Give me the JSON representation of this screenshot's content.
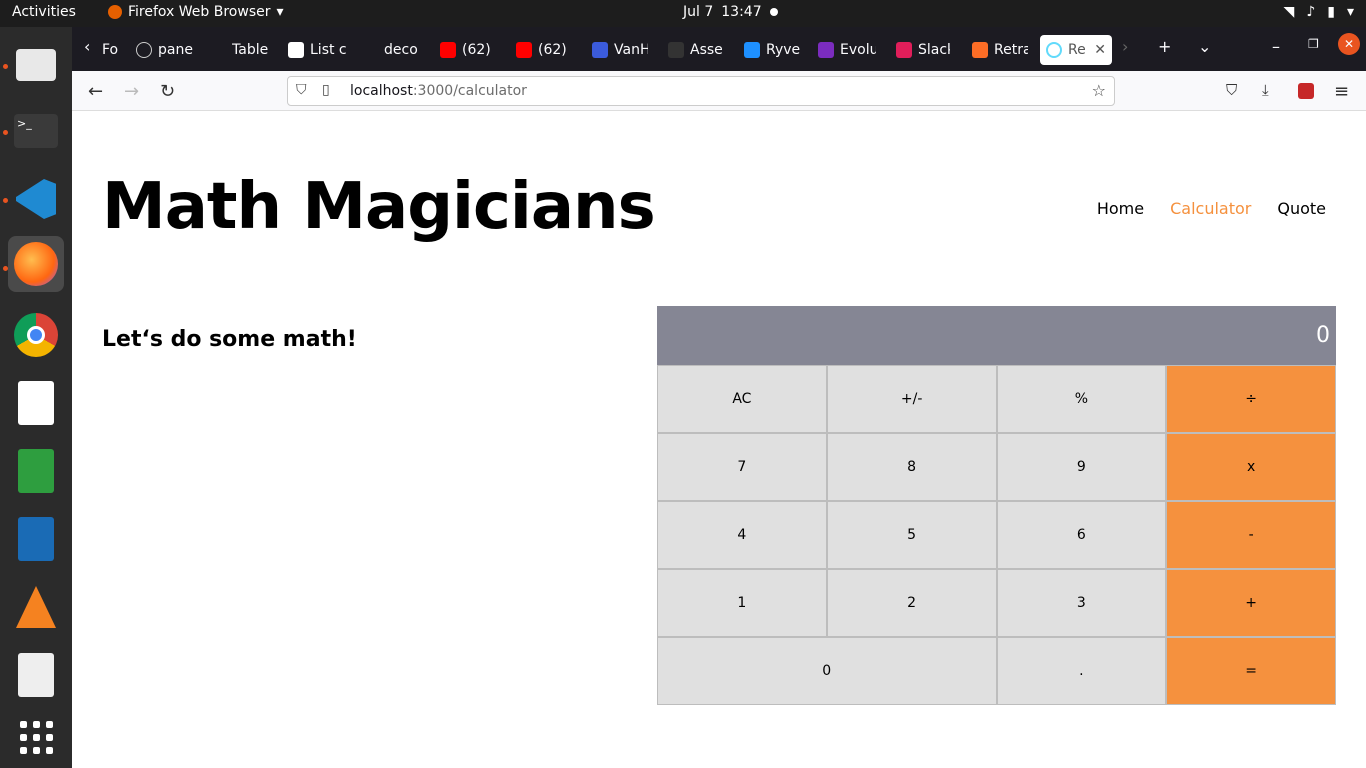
{
  "system": {
    "activities": "Activities",
    "app_name": "Firefox Web Browser",
    "date": "Jul 7",
    "time": "13:47"
  },
  "dock": [
    "files-icon",
    "terminal-icon",
    "vscode-icon",
    "firefox-icon",
    "chrome-icon",
    "text-editor-icon",
    "calc-icon",
    "writer-icon",
    "vlc-icon",
    "reader-icon",
    "apps-grid-icon"
  ],
  "tabs": [
    {
      "label": "Fo",
      "color": "#888"
    },
    {
      "label": "pane",
      "color": "#ccc"
    },
    {
      "label": "Table",
      "color": "#444"
    },
    {
      "label": "List c",
      "color": "#fff"
    },
    {
      "label": "deco",
      "color": "#444"
    },
    {
      "label": "(62)",
      "color": "#ff0000"
    },
    {
      "label": "(62)",
      "color": "#ff0000"
    },
    {
      "label": "VanH",
      "color": "#3b5bdb"
    },
    {
      "label": "Asse",
      "color": "#222"
    },
    {
      "label": "Ryve",
      "color": "#1e90ff"
    },
    {
      "label": "Evolu",
      "color": "#7b2cbf"
    },
    {
      "label": "Slack",
      "color": "#e01e5a"
    },
    {
      "label": "Retra",
      "color": "#fc6d26"
    },
    {
      "label": "Re",
      "color": "#61dafb"
    }
  ],
  "url": {
    "host": "localhost",
    "path": ":3000/calculator"
  },
  "page": {
    "logo": "Math Magicians",
    "nav": [
      "Home",
      "Calculator",
      "Quote"
    ],
    "intro": "Let‘s do some math!"
  },
  "calculator": {
    "display": "0",
    "keys": [
      "AC",
      "+/-",
      "%",
      "÷",
      "7",
      "8",
      "9",
      "x",
      "4",
      "5",
      "6",
      "-",
      "1",
      "2",
      "3",
      "+",
      "0",
      ".",
      "="
    ]
  },
  "colors": {
    "accent": "#f5913e",
    "display_bg": "#858694"
  }
}
